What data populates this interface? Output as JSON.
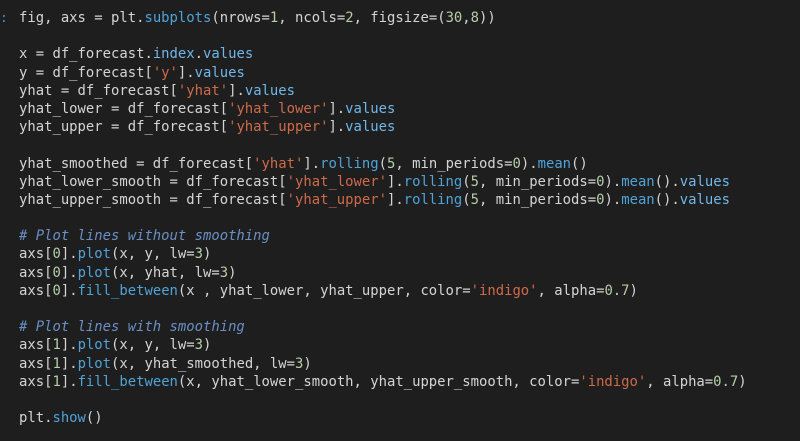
{
  "editor": {
    "gutter_marker": ":",
    "lines": [
      [
        {
          "t": "fig, axs = plt.",
          "c": ""
        },
        {
          "t": "subplots",
          "c": "t-fn"
        },
        {
          "t": "(nrows=",
          "c": ""
        },
        {
          "t": "1",
          "c": "t-num"
        },
        {
          "t": ", ncols=",
          "c": ""
        },
        {
          "t": "2",
          "c": "t-num"
        },
        {
          "t": ", figsize=(",
          "c": ""
        },
        {
          "t": "30",
          "c": "t-num"
        },
        {
          "t": ",",
          "c": ""
        },
        {
          "t": "8",
          "c": "t-num"
        },
        {
          "t": "))",
          "c": ""
        }
      ],
      [],
      [
        {
          "t": "x = df_forecast.",
          "c": ""
        },
        {
          "t": "index",
          "c": "t-attr"
        },
        {
          "t": ".",
          "c": ""
        },
        {
          "t": "values",
          "c": "t-attr"
        }
      ],
      [
        {
          "t": "y = df_forecast[",
          "c": ""
        },
        {
          "t": "'y'",
          "c": "t-str"
        },
        {
          "t": "].",
          "c": ""
        },
        {
          "t": "values",
          "c": "t-attr"
        }
      ],
      [
        {
          "t": "yhat = df_forecast[",
          "c": ""
        },
        {
          "t": "'yhat'",
          "c": "t-str"
        },
        {
          "t": "].",
          "c": ""
        },
        {
          "t": "values",
          "c": "t-attr"
        }
      ],
      [
        {
          "t": "yhat_lower = df_forecast[",
          "c": ""
        },
        {
          "t": "'yhat_lower'",
          "c": "t-str"
        },
        {
          "t": "].",
          "c": ""
        },
        {
          "t": "values",
          "c": "t-attr"
        }
      ],
      [
        {
          "t": "yhat_upper = df_forecast[",
          "c": ""
        },
        {
          "t": "'yhat_upper'",
          "c": "t-str"
        },
        {
          "t": "].",
          "c": ""
        },
        {
          "t": "values",
          "c": "t-attr"
        }
      ],
      [],
      [
        {
          "t": "yhat_smoothed = df_forecast[",
          "c": ""
        },
        {
          "t": "'yhat'",
          "c": "t-str"
        },
        {
          "t": "].",
          "c": ""
        },
        {
          "t": "rolling",
          "c": "t-fn"
        },
        {
          "t": "(",
          "c": ""
        },
        {
          "t": "5",
          "c": "t-num"
        },
        {
          "t": ", min_periods=",
          "c": ""
        },
        {
          "t": "0",
          "c": "t-num"
        },
        {
          "t": ").",
          "c": ""
        },
        {
          "t": "mean",
          "c": "t-fn"
        },
        {
          "t": "()",
          "c": ""
        }
      ],
      [
        {
          "t": "yhat_lower_smooth = df_forecast[",
          "c": ""
        },
        {
          "t": "'yhat_lower'",
          "c": "t-str"
        },
        {
          "t": "].",
          "c": ""
        },
        {
          "t": "rolling",
          "c": "t-fn"
        },
        {
          "t": "(",
          "c": ""
        },
        {
          "t": "5",
          "c": "t-num"
        },
        {
          "t": ", min_periods=",
          "c": ""
        },
        {
          "t": "0",
          "c": "t-num"
        },
        {
          "t": ").",
          "c": ""
        },
        {
          "t": "mean",
          "c": "t-fn"
        },
        {
          "t": "().",
          "c": ""
        },
        {
          "t": "values",
          "c": "t-attr"
        }
      ],
      [
        {
          "t": "yhat_upper_smooth = df_forecast[",
          "c": ""
        },
        {
          "t": "'yhat_upper'",
          "c": "t-str"
        },
        {
          "t": "].",
          "c": ""
        },
        {
          "t": "rolling",
          "c": "t-fn"
        },
        {
          "t": "(",
          "c": ""
        },
        {
          "t": "5",
          "c": "t-num"
        },
        {
          "t": ", min_periods=",
          "c": ""
        },
        {
          "t": "0",
          "c": "t-num"
        },
        {
          "t": ").",
          "c": ""
        },
        {
          "t": "mean",
          "c": "t-fn"
        },
        {
          "t": "().",
          "c": ""
        },
        {
          "t": "values",
          "c": "t-attr"
        }
      ],
      [],
      [
        {
          "t": "# Plot lines without smoothing",
          "c": "t-comment"
        }
      ],
      [
        {
          "t": "axs[",
          "c": ""
        },
        {
          "t": "0",
          "c": "t-num"
        },
        {
          "t": "].",
          "c": ""
        },
        {
          "t": "plot",
          "c": "t-fn"
        },
        {
          "t": "(x, y, lw=",
          "c": ""
        },
        {
          "t": "3",
          "c": "t-num"
        },
        {
          "t": ")",
          "c": ""
        }
      ],
      [
        {
          "t": "axs[",
          "c": ""
        },
        {
          "t": "0",
          "c": "t-num"
        },
        {
          "t": "].",
          "c": ""
        },
        {
          "t": "plot",
          "c": "t-fn"
        },
        {
          "t": "(x, yhat, lw=",
          "c": ""
        },
        {
          "t": "3",
          "c": "t-num"
        },
        {
          "t": ")",
          "c": ""
        }
      ],
      [
        {
          "t": "axs[",
          "c": ""
        },
        {
          "t": "0",
          "c": "t-num"
        },
        {
          "t": "].",
          "c": ""
        },
        {
          "t": "fill_between",
          "c": "t-fn"
        },
        {
          "t": "(x , yhat_lower, yhat_upper, color=",
          "c": ""
        },
        {
          "t": "'indigo'",
          "c": "t-str"
        },
        {
          "t": ", alpha=",
          "c": ""
        },
        {
          "t": "0.7",
          "c": "t-num"
        },
        {
          "t": ")",
          "c": ""
        }
      ],
      [],
      [
        {
          "t": "# Plot lines with smoothing",
          "c": "t-comment"
        }
      ],
      [
        {
          "t": "axs[",
          "c": ""
        },
        {
          "t": "1",
          "c": "t-num"
        },
        {
          "t": "].",
          "c": ""
        },
        {
          "t": "plot",
          "c": "t-fn"
        },
        {
          "t": "(x, y, lw=",
          "c": ""
        },
        {
          "t": "3",
          "c": "t-num"
        },
        {
          "t": ")",
          "c": ""
        }
      ],
      [
        {
          "t": "axs[",
          "c": ""
        },
        {
          "t": "1",
          "c": "t-num"
        },
        {
          "t": "].",
          "c": ""
        },
        {
          "t": "plot",
          "c": "t-fn"
        },
        {
          "t": "(x, yhat_smoothed, lw=",
          "c": ""
        },
        {
          "t": "3",
          "c": "t-num"
        },
        {
          "t": ")",
          "c": ""
        }
      ],
      [
        {
          "t": "axs[",
          "c": ""
        },
        {
          "t": "1",
          "c": "t-num"
        },
        {
          "t": "].",
          "c": ""
        },
        {
          "t": "fill_between",
          "c": "t-fn"
        },
        {
          "t": "(x, yhat_lower_smooth, yhat_upper_smooth, color=",
          "c": ""
        },
        {
          "t": "'indigo'",
          "c": "t-str"
        },
        {
          "t": ", alpha=",
          "c": ""
        },
        {
          "t": "0.7",
          "c": "t-num"
        },
        {
          "t": ")",
          "c": ""
        }
      ],
      [],
      [
        {
          "t": "plt.",
          "c": ""
        },
        {
          "t": "show",
          "c": "t-fn"
        },
        {
          "t": "()",
          "c": ""
        }
      ]
    ]
  },
  "colors": {
    "background": "#1e1e1e",
    "default_text": "#d4d4d4",
    "string": "#ce6a4a",
    "function": "#4fa3d9",
    "number": "#b5cea8",
    "comment": "#6a8fc4"
  }
}
